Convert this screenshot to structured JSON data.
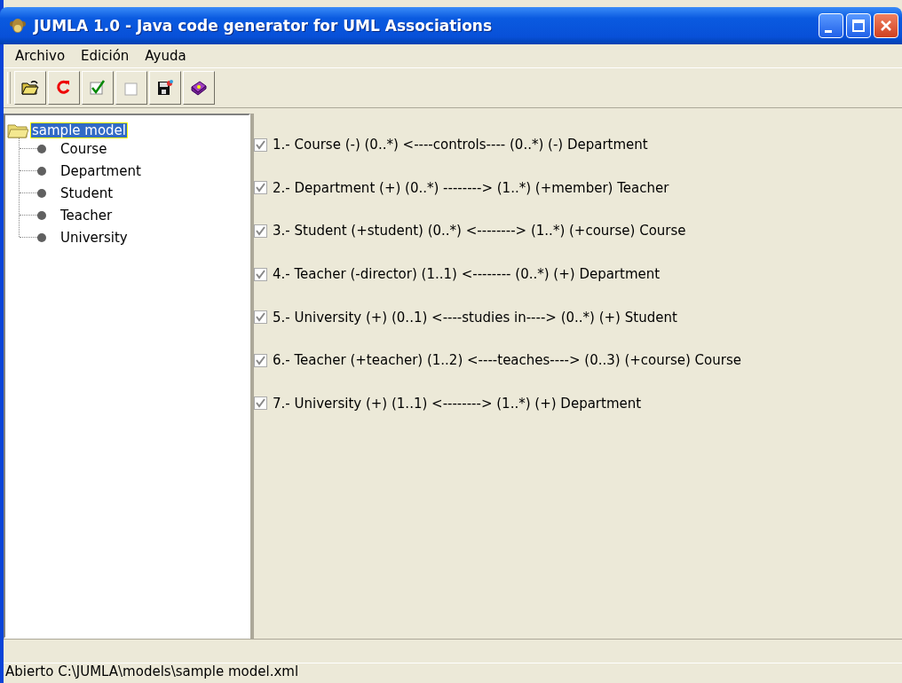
{
  "window": {
    "title": "JUMLA 1.0 - Java code generator for UML Associations"
  },
  "menu": [
    "Archivo",
    "Edición",
    "Ayuda"
  ],
  "toolbar": [
    {
      "kind": "open"
    },
    {
      "kind": "reload"
    },
    {
      "kind": "check"
    },
    {
      "kind": "uncheck"
    },
    {
      "kind": "save"
    },
    {
      "kind": "help"
    }
  ],
  "tree": {
    "label": "sample model",
    "selected": true,
    "children": [
      {
        "label": "Course",
        "selected": false
      },
      {
        "label": "Department",
        "selected": false
      },
      {
        "label": "Student",
        "selected": false
      },
      {
        "label": "Teacher",
        "selected": false
      },
      {
        "label": "University",
        "selected": false
      }
    ]
  },
  "associations": [
    {
      "text": "1.- Course (-) (0..*) <----controls---- (0..*) (-) Department",
      "checked": true
    },
    {
      "text": "2.- Department (+) (0..*) --------> (1..*) (+member) Teacher",
      "checked": true
    },
    {
      "text": "3.- Student (+student) (0..*) <--------> (1..*) (+course) Course",
      "checked": true
    },
    {
      "text": "4.- Teacher (-director) (1..1) <-------- (0..*) (+) Department",
      "checked": true
    },
    {
      "text": "5.- University (+) (0..1) <----studies in----> (0..*) (+) Student",
      "checked": true
    },
    {
      "text": "6.- Teacher (+teacher) (1..2) <----teaches----> (0..3) (+course) Course",
      "checked": true
    },
    {
      "text": "7.- University (+) (1..1) <--------> (1..*) (+) Department",
      "checked": true
    }
  ],
  "status_bar": "Abierto C:\\JUMLA\\models\\sample model.xml"
}
